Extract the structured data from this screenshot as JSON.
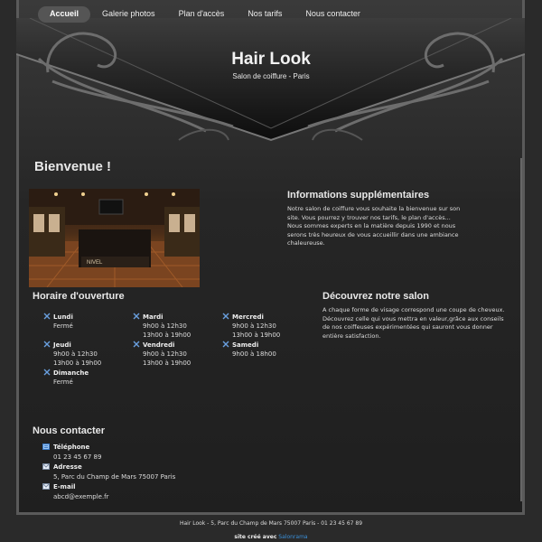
{
  "nav": {
    "items": [
      "Accueil",
      "Galerie photos",
      "Plan d'accès",
      "Nos tarifs",
      "Nous contacter"
    ]
  },
  "header": {
    "title": "Hair Look",
    "subtitle": "Salon de coiffure - Paris"
  },
  "main": {
    "welcome": "Bienvenue !",
    "info_title": "Informations supplémentaires",
    "info_lines": [
      "Notre salon de coiffure vous souhaite la bienvenue sur son",
      "site. Vous pourrez y trouver nos tarifs, le plan d'accès...",
      "Nous sommes experts en la matière depuis 1990 et nous",
      "serons très heureux de vous accueillir dans une ambiance",
      "chaleureuse."
    ],
    "photo_sign": "NIVEL",
    "hours_title": "Horaire d'ouverture",
    "hours": [
      {
        "day": "Lundi",
        "l1": "Fermé",
        "l2": ""
      },
      {
        "day": "Mardi",
        "l1": "9h00 à 12h30",
        "l2": "13h00 à 19h00"
      },
      {
        "day": "Mercredi",
        "l1": "9h00 à 12h30",
        "l2": "13h00 à 19h00"
      },
      {
        "day": "Jeudi",
        "l1": "9h00 à 12h30",
        "l2": "13h00 à 19h00"
      },
      {
        "day": "Vendredi",
        "l1": "9h00 à 12h30",
        "l2": "13h00 à 19h00"
      },
      {
        "day": "Samedi",
        "l1": "9h00 à 18h00",
        "l2": ""
      },
      {
        "day": "Dimanche",
        "l1": "Fermé",
        "l2": ""
      }
    ],
    "discover_title": "Découvrez notre salon",
    "discover_lines": [
      "A chaque forme de visage correspond une coupe de cheveux.",
      "Découvrez celle qui vous mettra en valeur,grâce aux conseils",
      "de nos coiffeuses expérimentées qui sauront vous donner",
      "entière satisfaction."
    ],
    "contact_title": "Nous contacter",
    "contacts": [
      {
        "label": "Téléphone",
        "value": "01 23 45 67 89"
      },
      {
        "label": "Adresse",
        "value": "5, Parc du Champ de Mars 75007 Paris"
      },
      {
        "label": "E-mail",
        "value": "abcd@exemple.fr"
      }
    ]
  },
  "footer": {
    "address": "Hair Look - 5, Parc du Champ de Mars 75007 Paris - 01 23 45 67 89",
    "credit_prefix": "site créé avec",
    "credit_link": "Salonrama"
  },
  "icons": [
    "scissors-icon",
    "phone-icon",
    "envelope-icon"
  ],
  "colors": {
    "background": "#2a2a2a",
    "link": "#3a8fd8",
    "nav_active": "#555555"
  }
}
